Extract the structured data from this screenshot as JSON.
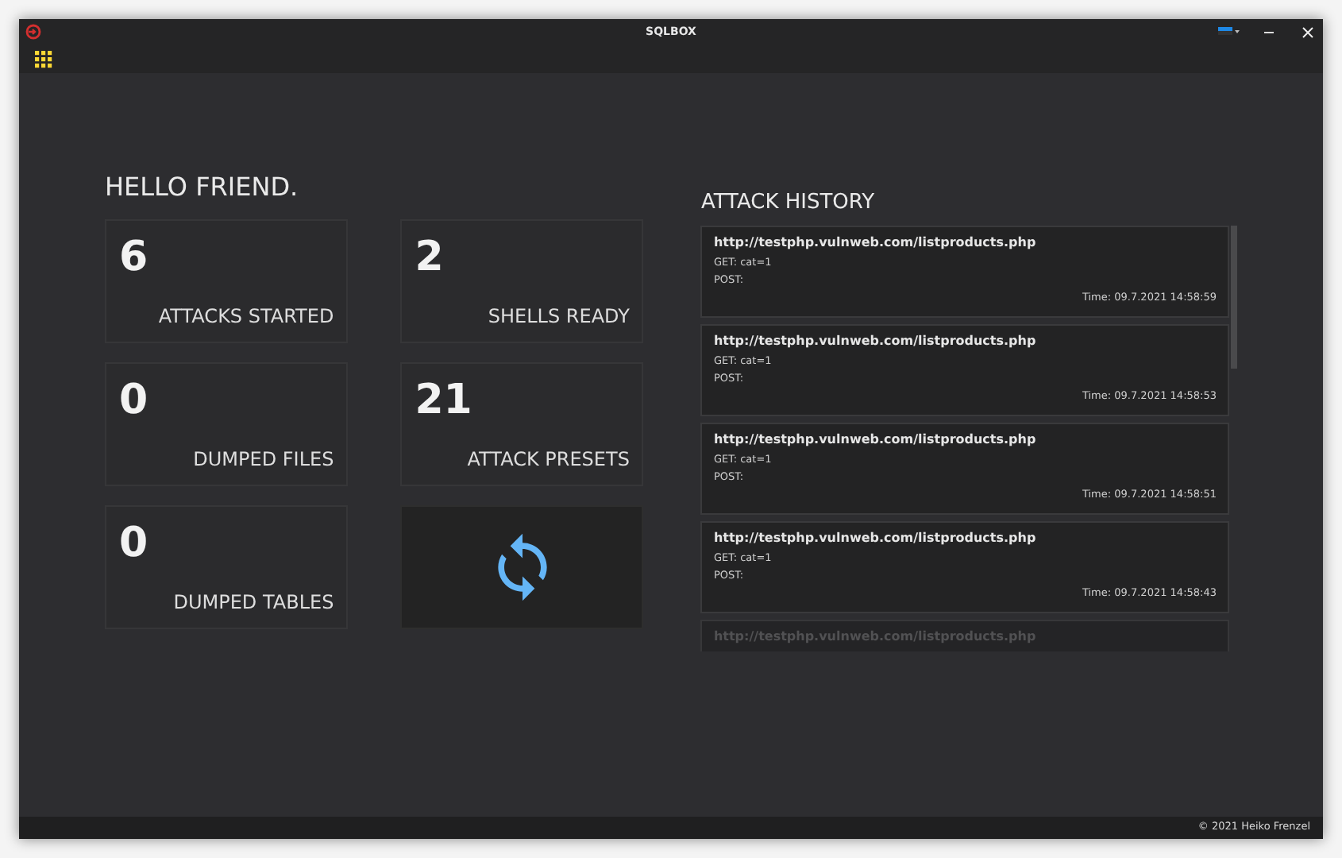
{
  "window": {
    "title": "SQLBOX"
  },
  "greeting": "HELLO FRIEND.",
  "stats": [
    {
      "kind": "stat",
      "value": "6",
      "label": "ATTACKS STARTED"
    },
    {
      "kind": "stat",
      "value": "2",
      "label": "SHELLS READY"
    },
    {
      "kind": "stat",
      "value": "0",
      "label": "DUMPED FILES"
    },
    {
      "kind": "stat",
      "value": "21",
      "label": "ATTACK PRESETS"
    },
    {
      "kind": "stat",
      "value": "0",
      "label": "DUMPED TABLES"
    },
    {
      "kind": "refresh"
    }
  ],
  "history": {
    "title": "ATTACK HISTORY",
    "items": [
      {
        "url": "http://testphp.vulnweb.com/listproducts.php",
        "get": "GET: cat=1",
        "post": "POST:",
        "time": "Time: 09.7.2021 14:58:59",
        "faded": false
      },
      {
        "url": "http://testphp.vulnweb.com/listproducts.php",
        "get": "GET: cat=1",
        "post": "POST:",
        "time": "Time: 09.7.2021 14:58:53",
        "faded": false
      },
      {
        "url": "http://testphp.vulnweb.com/listproducts.php",
        "get": "GET: cat=1",
        "post": "POST:",
        "time": "Time: 09.7.2021 14:58:51",
        "faded": false
      },
      {
        "url": "http://testphp.vulnweb.com/listproducts.php",
        "get": "GET: cat=1",
        "post": "POST:",
        "time": "Time: 09.7.2021 14:58:43",
        "faded": false
      },
      {
        "url": "http://testphp.vulnweb.com/listproducts.php",
        "faded": true
      }
    ]
  },
  "status_bar": "© 2021 Heiko Frenzel"
}
